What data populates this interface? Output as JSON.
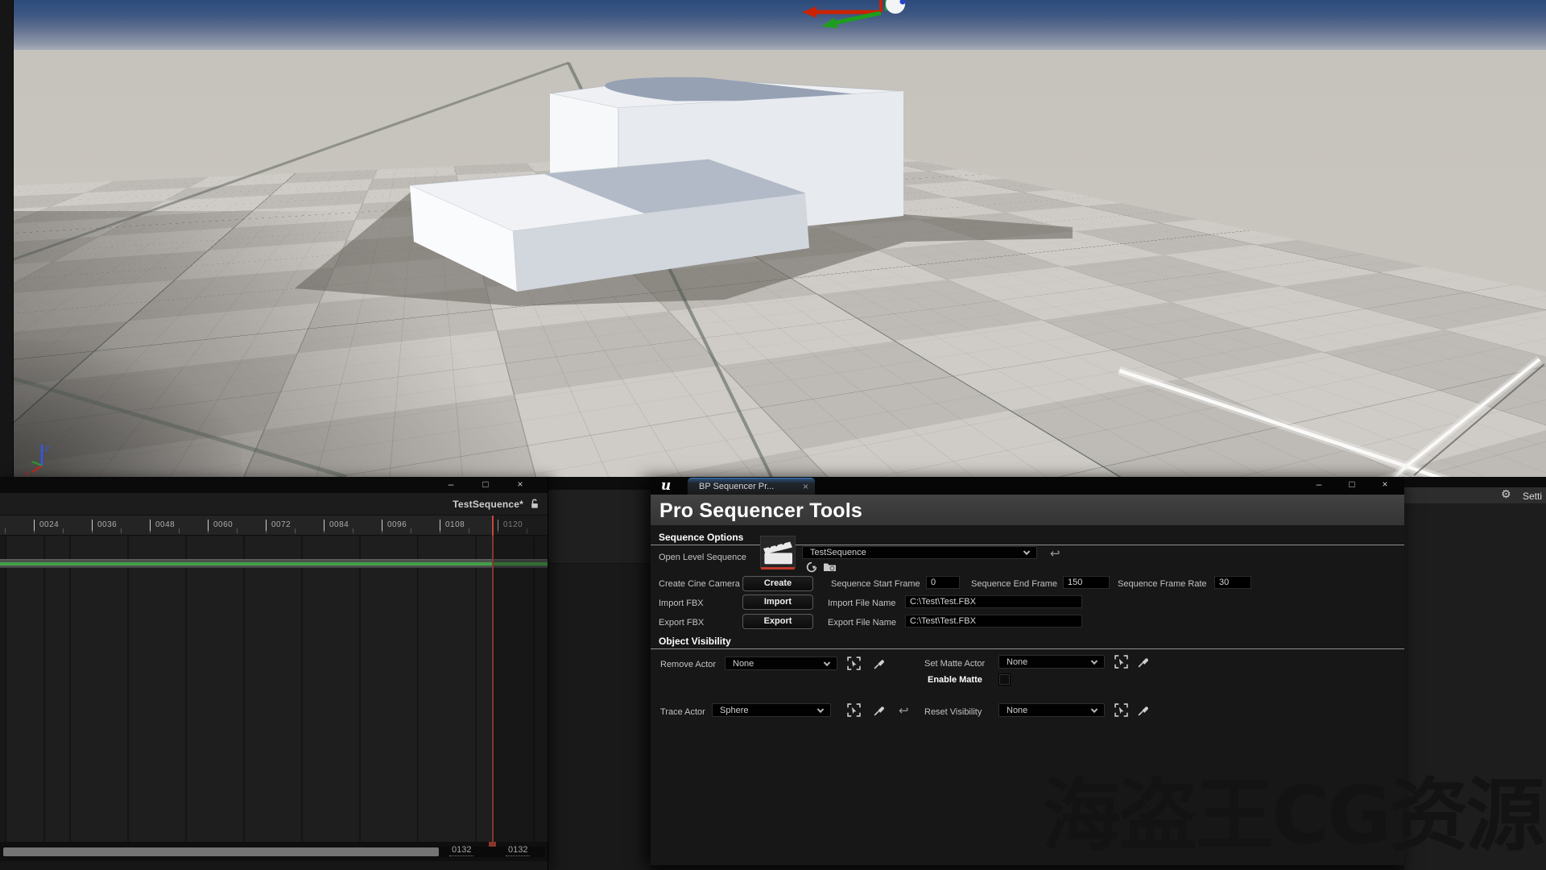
{
  "watermark": {
    "text": "海盗王CG资源"
  },
  "icons": {
    "undo": "↩",
    "gear": "⚙",
    "minimize": "–",
    "maximize": "□",
    "close": "×"
  },
  "viewport": {
    "axis_x_label": "x",
    "axis_z_label": "z"
  },
  "right_panel": {
    "settings_label": "Setti"
  },
  "sequencer": {
    "sequence_name": "TestSequence*",
    "ruler_labels": [
      "0024",
      "0036",
      "0048",
      "0060",
      "0072",
      "0084",
      "0096",
      "0108",
      "0120"
    ],
    "range_end": "0132",
    "range_total": "0132"
  },
  "bp_window": {
    "tab_label": "BP Sequencer Pr...",
    "logo": "u",
    "title": "Pro Sequencer Tools",
    "sequence_options": {
      "header": "Sequence Options",
      "open_level_sequence_label": "Open Level Sequence",
      "sequence_dropdown_value": "TestSequence",
      "create_cine_camera_label": "Create Cine Camera",
      "create_button": "Create",
      "sequence_start_frame_label": "Sequence Start Frame",
      "sequence_start_frame_value": "0",
      "sequence_end_frame_label": "Sequence End Frame",
      "sequence_end_frame_value": "150",
      "sequence_frame_rate_label": "Sequence Frame Rate",
      "sequence_frame_rate_value": "30",
      "import_fbx_label": "Import FBX",
      "import_button": "Import",
      "import_file_name_label": "Import File Name",
      "import_file_name_value": "C:\\Test\\Test.FBX",
      "export_fbx_label": "Export FBX",
      "export_button": "Export",
      "export_file_name_label": "Export File Name",
      "export_file_name_value": "C:\\Test\\Test.FBX"
    },
    "object_visibility": {
      "header": "Object Visibility",
      "remove_actor_label": "Remove Actor",
      "remove_actor_value": "None",
      "set_matte_actor_label": "Set Matte Actor",
      "set_matte_actor_value": "None",
      "enable_matte_label": "Enable Matte",
      "trace_actor_label": "Trace Actor",
      "trace_actor_value": "Sphere",
      "reset_visibility_label": "Reset Visibility",
      "reset_visibility_value": "None"
    }
  }
}
